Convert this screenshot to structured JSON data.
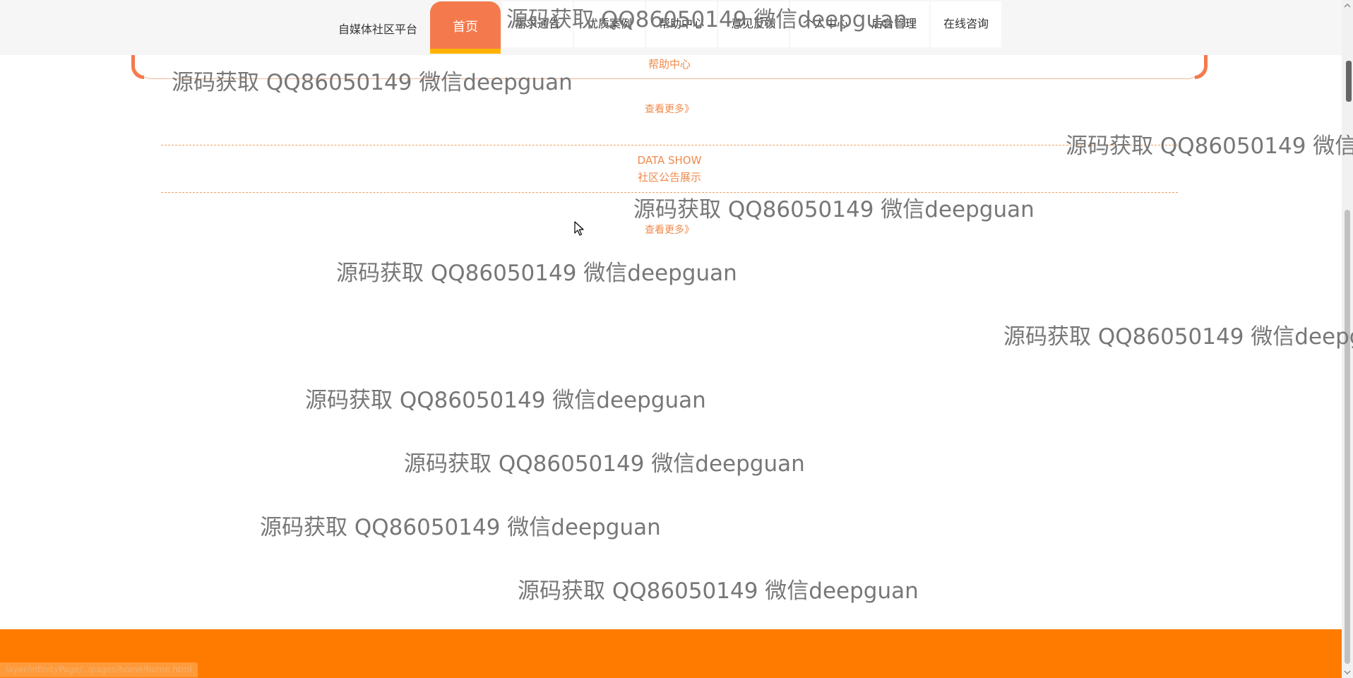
{
  "header": {
    "brand": "自媒体社区平台",
    "nav": [
      {
        "label": "首页",
        "active": true
      },
      {
        "label": "需求通告"
      },
      {
        "label": "优质案例"
      },
      {
        "label": "帮助中心"
      },
      {
        "label": "意见反馈"
      },
      {
        "label": "个人中心"
      },
      {
        "label": "后台管理"
      },
      {
        "label": "在线咨询"
      }
    ]
  },
  "sections": {
    "help": {
      "title": "帮助中心",
      "more": "查看更多》"
    },
    "data_show": {
      "title_en": "DATA SHOW",
      "title_cn": "社区公告展示",
      "more": "查看更多》"
    }
  },
  "watermark_text": "源码获取 QQ86050149 微信deepguan",
  "status_bar_url": "layer/infinityPage/../pages/home/home.html",
  "colors": {
    "accent": "#f47a4e",
    "accent_text": "#f08a4b",
    "underline": "#ffb400",
    "footer": "#ff7b00",
    "nav_bg": "#f6f6f6"
  },
  "icons": {
    "cursor": "mouse-pointer-icon",
    "scroll_up": "chevron-up-icon",
    "scroll_down": "chevron-down-icon"
  }
}
